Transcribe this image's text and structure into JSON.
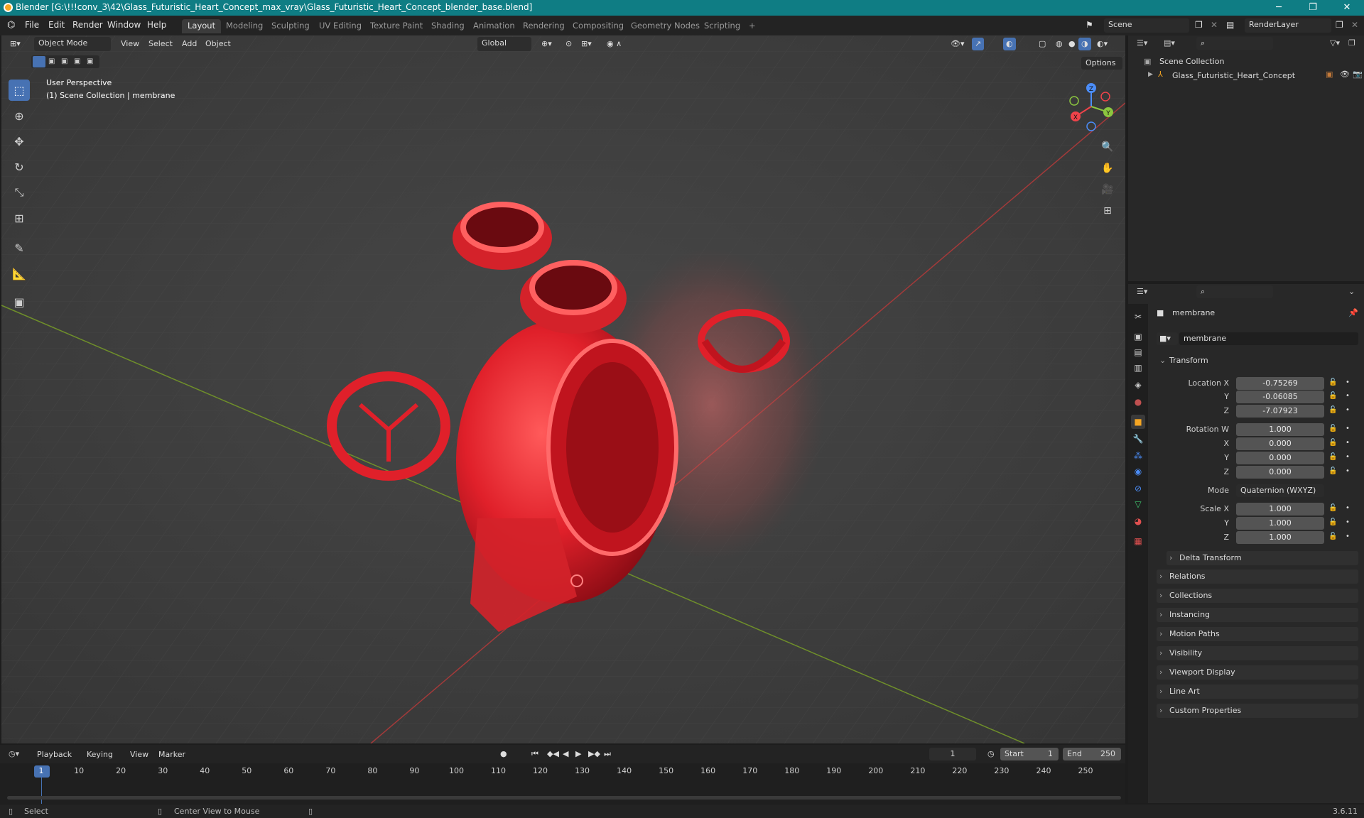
{
  "window": {
    "title": "Blender [G:\\!!!conv_3\\42\\Glass_Futuristic_Heart_Concept_max_vray\\Glass_Futuristic_Heart_Concept_blender_base.blend]",
    "minimize": "─",
    "maximize": "❐",
    "close": "✕"
  },
  "menu": {
    "items": [
      "File",
      "Edit",
      "Render",
      "Window",
      "Help"
    ],
    "workspaces": [
      "Layout",
      "Modeling",
      "Sculpting",
      "UV Editing",
      "Texture Paint",
      "Shading",
      "Animation",
      "Rendering",
      "Compositing",
      "Geometry Nodes",
      "Scripting"
    ],
    "add_tab": "+",
    "scene": "Scene",
    "render_layer": "RenderLayer"
  },
  "viewport": {
    "mode": "Object Mode",
    "menus": [
      "View",
      "Select",
      "Add",
      "Object"
    ],
    "orientation": "Global",
    "options": "Options",
    "overlay_line1": "User Perspective",
    "overlay_line2": "(1) Scene Collection | membrane",
    "gizmo_axes": [
      "X",
      "Y",
      "Z"
    ]
  },
  "outliner": {
    "root": "Scene Collection",
    "items": [
      "Glass_Futuristic_Heart_Concept"
    ]
  },
  "properties": {
    "object_name": "membrane",
    "object_field": "membrane",
    "transform_label": "Transform",
    "location": {
      "label_x": "Location X",
      "label_y": "Y",
      "label_z": "Z",
      "x": "-0.75269",
      "y": "-0.06085",
      "z": "-7.07923"
    },
    "rotation": {
      "label_w": "Rotation W",
      "label_x": "X",
      "label_y": "Y",
      "label_z": "Z",
      "w": "1.000",
      "x": "0.000",
      "y": "0.000",
      "z": "0.000"
    },
    "mode_label": "Mode",
    "mode_value": "Quaternion (WXYZ)",
    "scale": {
      "label_x": "Scale X",
      "label_y": "Y",
      "label_z": "Z",
      "x": "1.000",
      "y": "1.000",
      "z": "1.000"
    },
    "delta_transform": "Delta Transform",
    "sections": [
      "Relations",
      "Collections",
      "Instancing",
      "Motion Paths",
      "Visibility",
      "Viewport Display",
      "Line Art",
      "Custom Properties"
    ]
  },
  "timeline": {
    "menus": [
      "Playback",
      "Keying",
      "View",
      "Marker"
    ],
    "current_frame": "1",
    "start_label": "Start",
    "start": "1",
    "end_label": "End",
    "end": "250",
    "ticks": [
      "1",
      "10",
      "20",
      "30",
      "40",
      "50",
      "60",
      "70",
      "80",
      "90",
      "100",
      "110",
      "120",
      "130",
      "140",
      "150",
      "160",
      "170",
      "180",
      "190",
      "200",
      "210",
      "220",
      "230",
      "240",
      "250"
    ]
  },
  "status": {
    "select": "Select",
    "center": "Center View to Mouse",
    "version": "3.6.11"
  },
  "colors": {
    "accent": "#4772b3",
    "titlebar": "#0f7d84",
    "object": "#e0202a"
  }
}
